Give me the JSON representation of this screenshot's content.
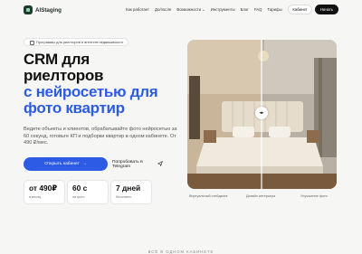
{
  "header": {
    "logo_text": "AIStaging",
    "nav": [
      "Как работает",
      "До/после",
      "Возможности ⌄",
      "Инструменты",
      "Блог",
      "FAQ",
      "Тарифы"
    ],
    "cabinet_label": "Кабинет",
    "login_label": "Начать"
  },
  "hero": {
    "badge": "Программы для риелторов и агентств недвижимости",
    "title_line1": "CRM для",
    "title_line2": "риелторов",
    "title_line3": "с нейросетью для",
    "title_line4": "фото квартир",
    "description": "Ведите объекты и клиентов, обрабатывайте фото нейросетью за 60 секунд, готовьте КП и подборки квартир в одном кабинете. От 490 ₽/мес.",
    "primary_cta": "Открыть кабинет",
    "secondary_cta": "Попробовать в Telegram",
    "stats": [
      {
        "value": "от 490₽",
        "label": "в месяц"
      },
      {
        "value": "60 с",
        "label": "на фото"
      },
      {
        "value": "7 дней",
        "label": "бесплатно"
      }
    ],
    "captions": [
      "Виртуальный стейджинг",
      "Дизайн интерьера",
      "Улучшение фото"
    ],
    "slider_value": 0.5
  },
  "section_label": "ВСЁ В ОДНОМ КАБИНЕТЕ",
  "colors": {
    "accent": "#2d5be3",
    "dark": "#111111",
    "background": "#f6f6f4"
  }
}
